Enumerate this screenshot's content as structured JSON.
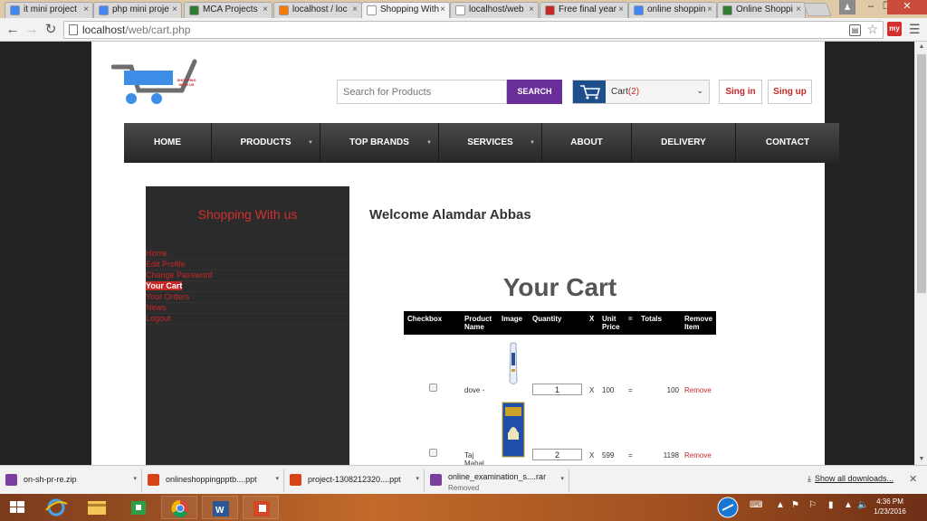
{
  "browser": {
    "tabs": [
      {
        "title": "it mini project",
        "icon": "google-icon",
        "color": "#4285f4"
      },
      {
        "title": "php mini proje",
        "icon": "google-icon",
        "color": "#4285f4"
      },
      {
        "title": "MCA Projects",
        "icon": "site-icon",
        "color": "#2e7d32"
      },
      {
        "title": "localhost / loc",
        "icon": "pma-icon",
        "color": "#f57c00"
      },
      {
        "title": "Shopping With",
        "icon": "page-icon",
        "color": "#ffffff"
      },
      {
        "title": "localhost/web",
        "icon": "page-icon",
        "color": "#ffffff"
      },
      {
        "title": "Free final year",
        "icon": "pause-icon",
        "color": "#c62828"
      },
      {
        "title": "online shoppin",
        "icon": "google-icon",
        "color": "#4285f4"
      },
      {
        "title": "Online Shoppi",
        "icon": "site-icon",
        "color": "#2e7d32"
      }
    ],
    "url_host": "localhost",
    "url_path": "/web/cart.php",
    "ext_label": "my"
  },
  "site": {
    "logo_text": "SHOPPING WITH US",
    "search_placeholder": "Search for Products",
    "search_button": "SEARCH",
    "cart_label": "Cart",
    "cart_count": "(2)",
    "signin": "Sing in",
    "signup": "Sing up",
    "nav": [
      "HOME",
      "PRODUCTS",
      "TOP BRANDS",
      "SERVICES",
      "ABOUT",
      "DELIVERY",
      "CONTACT"
    ],
    "sidebar_title": "Shopping With us",
    "sidebar_items": [
      "Home",
      "Edit Profile",
      "Change Password",
      "Your Cart",
      "Your Orders",
      "News",
      "Logout"
    ],
    "welcome": "Welcome  Alamdar Abbas",
    "cart_title": "Your Cart",
    "cart_headers": [
      "Checkbox",
      "Product Name",
      "Image",
      "Quantity",
      "X",
      "Unit Price",
      "=",
      "Totals",
      "Remove Item"
    ],
    "cart_rows": [
      {
        "name": "dove -",
        "qty": "1",
        "x": "X",
        "price": "100",
        "eq": "=",
        "total": "100",
        "remove": "Remove"
      },
      {
        "name": "Taj Mahal",
        "qty": "2",
        "x": "X",
        "price": "599",
        "eq": "=",
        "total": "1198",
        "remove": "Remove"
      }
    ]
  },
  "downloads": {
    "items": [
      {
        "name": "on-sh-pr-re.zip",
        "status": "",
        "color": "#7b3fa0"
      },
      {
        "name": "onlineshoppingpptb....ppt",
        "status": "",
        "color": "#d84315"
      },
      {
        "name": "project-1308212320....ppt",
        "status": "",
        "color": "#d84315"
      },
      {
        "name": "online_examination_s....rar",
        "status": "Removed",
        "color": "#7b3fa0"
      }
    ],
    "show_all": "Show all downloads..."
  },
  "taskbar": {
    "time": "4:36 PM",
    "date": "1/23/2016"
  }
}
